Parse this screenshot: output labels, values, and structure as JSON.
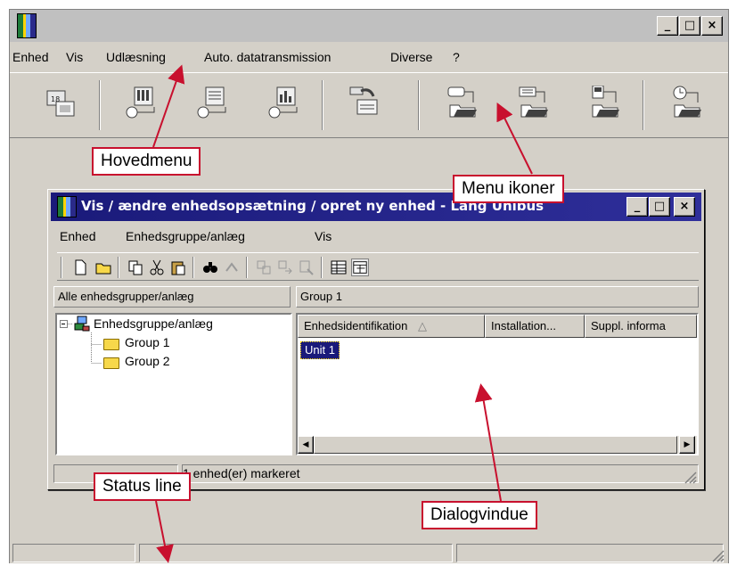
{
  "app": {
    "window_buttons": {
      "minimize": "_",
      "maximize": "□",
      "close": "×"
    },
    "menu": [
      {
        "label": "Enhed",
        "accel": "E"
      },
      {
        "label": "Vis",
        "accel": "i"
      },
      {
        "label": "Udlæsning",
        "accel": "U"
      },
      {
        "label": "Auto. datatransmission",
        "accel": "A"
      },
      {
        "label": "Diverse",
        "accel": "D"
      },
      {
        "label": "?",
        "accel": ""
      }
    ],
    "toolbar_icons": [
      "unit-data-icon",
      "read-unit-icon",
      "read-events-icon",
      "read-chart-icon",
      "transfer-data-icon",
      "open-folder-icon",
      "open-data-folder-icon",
      "save-folder-icon",
      "scheduled-folder-icon"
    ]
  },
  "dialog": {
    "title": "Vis / ændre enhedsopsætning / opret ny enhed - Lang Unibus",
    "menu": [
      {
        "label": "Enhed",
        "accel": "E"
      },
      {
        "label": "Enhedsgruppe/anlæg",
        "accel": "n"
      },
      {
        "label": "Vis",
        "accel": "V"
      }
    ],
    "left_header": "Alle enhedsgrupper/anlæg",
    "right_header": "Group 1",
    "tree": {
      "root": "Enhedsgruppe/anlæg",
      "children": [
        "Group 1",
        "Group 2"
      ]
    },
    "columns": [
      "Enhedsidentifikation",
      "Installation...",
      "Suppl. informa"
    ],
    "sort_indicator": "△",
    "rows": [
      "Unit 1"
    ],
    "status_text": "1 enhed(er) markeret"
  },
  "callouts": {
    "hovedmenu": "Hovedmenu",
    "menu_ikoner": "Menu ikoner",
    "status_line": "Status line",
    "dialogvindue": "Dialogvindue"
  },
  "colors": {
    "callout_border": "#c8102e",
    "dialog_title_bg": "#1a1a7a",
    "selection_bg": "#1a1a7a",
    "chrome": "#d4d0c8"
  }
}
